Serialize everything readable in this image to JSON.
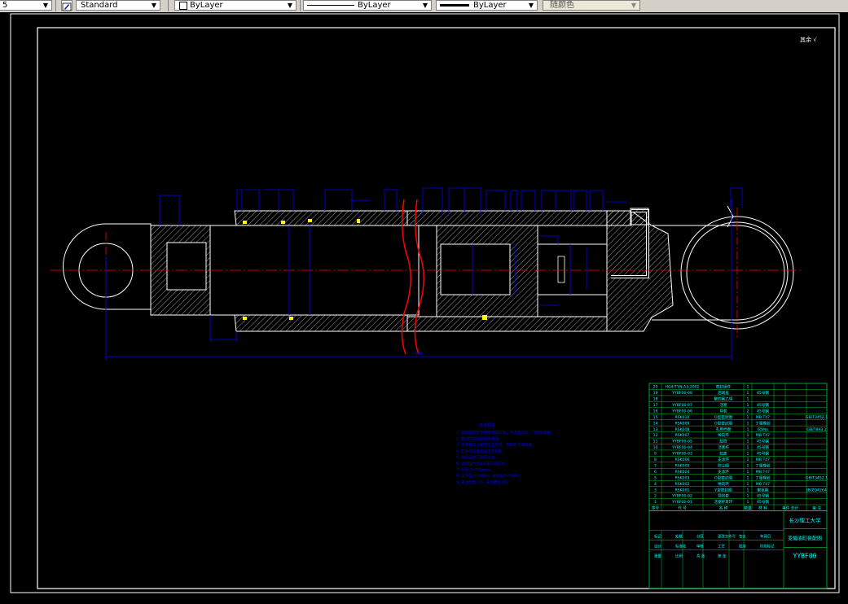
{
  "toolbar": {
    "left_value": "5",
    "text_style": "Standard",
    "layer": "ByLayer",
    "linetype": "ByLayer",
    "lineweight": "ByLayer",
    "color": "随颜色"
  },
  "drawing": {
    "roughness_mark": "其余 √",
    "dim_total": "1440",
    "tech_title": "技术要求",
    "tech_notes": [
      "1. 装配前所有零件需清洗干净，不得有毛刺、飞边等杂物。",
      "2. 密封件装配时涂润滑油。",
      "3. 活塞杆与活塞配合应灵活，不得有卡滞现象。",
      "4. 缸体内表面应光滑无划痕。",
      "5. 装配后进行耐压试验。",
      "6. 试验压力为1.5倍工作压力。",
      "7. 行程 S=785mm。",
      "8. 工作压力16MPa，试验压力25MPa。",
      "9. 未注倒角 C1，未注圆角 R1。"
    ],
    "parts": [
      {
        "no": "20",
        "code": "HG4/TY.N.A3-2002",
        "name": "密封组件",
        "qty": "1",
        "mat": "",
        "note": ""
      },
      {
        "no": "19",
        "code": "YYBF00-08",
        "name": "后端盖",
        "qty": "1",
        "mat": "45号钢",
        "note": ""
      },
      {
        "no": "18",
        "code": "",
        "name": "聚四氟乙烯",
        "qty": "1",
        "mat": "",
        "note": ""
      },
      {
        "no": "17",
        "code": "YYBF00-07",
        "name": "活塞",
        "qty": "1",
        "mat": "45号钢",
        "note": ""
      },
      {
        "no": "16",
        "code": "YYBF00-06",
        "name": "导套",
        "qty": "2",
        "mat": "45号钢",
        "note": ""
      },
      {
        "no": "15",
        "code": "RSK010",
        "name": "O型密封圈",
        "qty": "1",
        "mat": "MB T47",
        "note": "GB/T3452.1"
      },
      {
        "no": "14",
        "code": "RSK009",
        "name": "O型密封圈",
        "qty": "1",
        "mat": "丁腈橡胶",
        "note": ""
      },
      {
        "no": "13",
        "code": "RSK008",
        "name": "孔用挡圈",
        "qty": "1",
        "mat": "65Mn",
        "note": "GB/T893.1"
      },
      {
        "no": "12",
        "code": "RSK007",
        "name": "导向环",
        "qty": "1",
        "mat": "MB T47",
        "note": ""
      },
      {
        "no": "11",
        "code": "YYBF00-05",
        "name": "缸筒",
        "qty": "1",
        "mat": "45号钢",
        "note": ""
      },
      {
        "no": "10",
        "code": "YYBF00-04",
        "name": "活塞杆",
        "qty": "1",
        "mat": "45号钢",
        "note": ""
      },
      {
        "no": "9",
        "code": "YYBF00-03",
        "name": "缸底",
        "qty": "1",
        "mat": "45号钢",
        "note": ""
      },
      {
        "no": "8",
        "code": "RSK006",
        "name": "支承环",
        "qty": "1",
        "mat": "MB T47",
        "note": ""
      },
      {
        "no": "7",
        "code": "RSK005",
        "name": "防尘圈",
        "qty": "1",
        "mat": "丁腈橡胶",
        "note": ""
      },
      {
        "no": "6",
        "code": "RSK004",
        "name": "支承环",
        "qty": "1",
        "mat": "MB T47",
        "note": ""
      },
      {
        "no": "5",
        "code": "RSK003",
        "name": "O型密封圈",
        "qty": "1",
        "mat": "丁腈橡胶",
        "note": "GB/T3452.1"
      },
      {
        "no": "4",
        "code": "RSK002",
        "name": "导向环",
        "qty": "1",
        "mat": "MB T47",
        "note": ""
      },
      {
        "no": "3",
        "code": "RSK001",
        "name": "Y型密封圈",
        "qty": "1",
        "mat": "聚氨酯",
        "note": "JB/ZQ4264"
      },
      {
        "no": "2",
        "code": "YYBF00-02",
        "name": "导向套",
        "qty": "1",
        "mat": "45号钢",
        "note": ""
      },
      {
        "no": "1",
        "code": "YYBF00-01",
        "name": "活塞杆耳环",
        "qty": "1",
        "mat": "45号钢",
        "note": ""
      }
    ],
    "header": {
      "no": "序号",
      "code": "代 号",
      "name": "名 称",
      "qty": "数量",
      "mat": "材 料",
      "weight": "单件 总计",
      "note": "备 注"
    },
    "title_block": {
      "school": "长沙理工大学",
      "drawing_title": "变幅油缸装配图",
      "drawing_no": "YYBF00",
      "labels": [
        "标记",
        "处数",
        "分区",
        "更改文件号",
        "签名",
        "年月日",
        "设计",
        "标准化",
        "审核",
        "工艺",
        "批准",
        "阶段标记",
        "重量",
        "比例",
        "共 张",
        "第 张"
      ]
    }
  },
  "colors": {
    "bg": "#000000",
    "line": "#ffffff",
    "dim": "#0000ff",
    "center": "#ff0000",
    "table_line": "#00cc33",
    "table_text": "#00ffff",
    "hatch": "#ffffff",
    "seal": "#ffff00"
  }
}
